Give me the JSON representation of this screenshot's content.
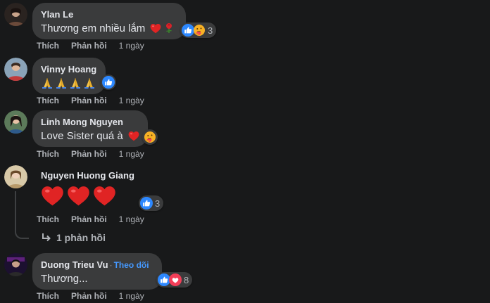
{
  "actions": {
    "like": "Thích",
    "reply": "Phản hồi"
  },
  "comments": [
    {
      "author": "Ylan Le",
      "text": "Thương em nhiều lắm",
      "inline_emojis": [
        "heart-emoji",
        "rose-emoji"
      ],
      "reaction_icons": [
        "like-reaction",
        "care-reaction"
      ],
      "reaction_count": "3",
      "time": "1 ngày"
    },
    {
      "author": "Vinny Hoang",
      "text": "🙏🙏🙏🙏",
      "reaction_icons": [
        "like-reaction"
      ],
      "reaction_count": "",
      "time": "1 ngày"
    },
    {
      "author": "Linh Mong Nguyen",
      "text": "Love Sister quá à",
      "inline_emojis": [
        "heart-emoji"
      ],
      "reaction_icons": [
        "care-reaction"
      ],
      "reaction_count": "",
      "time": "1 ngày"
    },
    {
      "author": "Nguyen Huong Giang",
      "text": "❤❤❤",
      "reaction_icons": [
        "like-reaction"
      ],
      "reaction_count": "3",
      "time": "1 ngày",
      "replies_label": "1 phản hồi"
    },
    {
      "author": "Duong Trieu Vu",
      "follow_label": "Theo dõi",
      "text": "Thương...",
      "reaction_icons": [
        "like-reaction",
        "love-reaction"
      ],
      "reaction_count": "8",
      "time": "1 ngày"
    }
  ],
  "colors": {
    "background": "#18191a",
    "bubble": "#3a3b3c",
    "primary_text": "#e4e6eb",
    "secondary_text": "#b0b3b8",
    "link": "#4599ff",
    "like_blue": "#2d88ff",
    "heart_red": "#e02424"
  }
}
